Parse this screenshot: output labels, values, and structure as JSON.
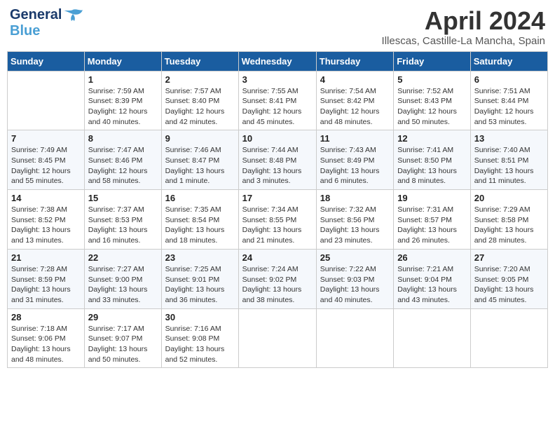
{
  "header": {
    "logo_line1": "General",
    "logo_line2": "Blue",
    "title": "April 2024",
    "subtitle": "Illescas, Castille-La Mancha, Spain"
  },
  "days_of_week": [
    "Sunday",
    "Monday",
    "Tuesday",
    "Wednesday",
    "Thursday",
    "Friday",
    "Saturday"
  ],
  "weeks": [
    [
      {
        "day": "",
        "sunrise": "",
        "sunset": "",
        "daylight": ""
      },
      {
        "day": "1",
        "sunrise": "Sunrise: 7:59 AM",
        "sunset": "Sunset: 8:39 PM",
        "daylight": "Daylight: 12 hours and 40 minutes."
      },
      {
        "day": "2",
        "sunrise": "Sunrise: 7:57 AM",
        "sunset": "Sunset: 8:40 PM",
        "daylight": "Daylight: 12 hours and 42 minutes."
      },
      {
        "day": "3",
        "sunrise": "Sunrise: 7:55 AM",
        "sunset": "Sunset: 8:41 PM",
        "daylight": "Daylight: 12 hours and 45 minutes."
      },
      {
        "day": "4",
        "sunrise": "Sunrise: 7:54 AM",
        "sunset": "Sunset: 8:42 PM",
        "daylight": "Daylight: 12 hours and 48 minutes."
      },
      {
        "day": "5",
        "sunrise": "Sunrise: 7:52 AM",
        "sunset": "Sunset: 8:43 PM",
        "daylight": "Daylight: 12 hours and 50 minutes."
      },
      {
        "day": "6",
        "sunrise": "Sunrise: 7:51 AM",
        "sunset": "Sunset: 8:44 PM",
        "daylight": "Daylight: 12 hours and 53 minutes."
      }
    ],
    [
      {
        "day": "7",
        "sunrise": "Sunrise: 7:49 AM",
        "sunset": "Sunset: 8:45 PM",
        "daylight": "Daylight: 12 hours and 55 minutes."
      },
      {
        "day": "8",
        "sunrise": "Sunrise: 7:47 AM",
        "sunset": "Sunset: 8:46 PM",
        "daylight": "Daylight: 12 hours and 58 minutes."
      },
      {
        "day": "9",
        "sunrise": "Sunrise: 7:46 AM",
        "sunset": "Sunset: 8:47 PM",
        "daylight": "Daylight: 13 hours and 1 minute."
      },
      {
        "day": "10",
        "sunrise": "Sunrise: 7:44 AM",
        "sunset": "Sunset: 8:48 PM",
        "daylight": "Daylight: 13 hours and 3 minutes."
      },
      {
        "day": "11",
        "sunrise": "Sunrise: 7:43 AM",
        "sunset": "Sunset: 8:49 PM",
        "daylight": "Daylight: 13 hours and 6 minutes."
      },
      {
        "day": "12",
        "sunrise": "Sunrise: 7:41 AM",
        "sunset": "Sunset: 8:50 PM",
        "daylight": "Daylight: 13 hours and 8 minutes."
      },
      {
        "day": "13",
        "sunrise": "Sunrise: 7:40 AM",
        "sunset": "Sunset: 8:51 PM",
        "daylight": "Daylight: 13 hours and 11 minutes."
      }
    ],
    [
      {
        "day": "14",
        "sunrise": "Sunrise: 7:38 AM",
        "sunset": "Sunset: 8:52 PM",
        "daylight": "Daylight: 13 hours and 13 minutes."
      },
      {
        "day": "15",
        "sunrise": "Sunrise: 7:37 AM",
        "sunset": "Sunset: 8:53 PM",
        "daylight": "Daylight: 13 hours and 16 minutes."
      },
      {
        "day": "16",
        "sunrise": "Sunrise: 7:35 AM",
        "sunset": "Sunset: 8:54 PM",
        "daylight": "Daylight: 13 hours and 18 minutes."
      },
      {
        "day": "17",
        "sunrise": "Sunrise: 7:34 AM",
        "sunset": "Sunset: 8:55 PM",
        "daylight": "Daylight: 13 hours and 21 minutes."
      },
      {
        "day": "18",
        "sunrise": "Sunrise: 7:32 AM",
        "sunset": "Sunset: 8:56 PM",
        "daylight": "Daylight: 13 hours and 23 minutes."
      },
      {
        "day": "19",
        "sunrise": "Sunrise: 7:31 AM",
        "sunset": "Sunset: 8:57 PM",
        "daylight": "Daylight: 13 hours and 26 minutes."
      },
      {
        "day": "20",
        "sunrise": "Sunrise: 7:29 AM",
        "sunset": "Sunset: 8:58 PM",
        "daylight": "Daylight: 13 hours and 28 minutes."
      }
    ],
    [
      {
        "day": "21",
        "sunrise": "Sunrise: 7:28 AM",
        "sunset": "Sunset: 8:59 PM",
        "daylight": "Daylight: 13 hours and 31 minutes."
      },
      {
        "day": "22",
        "sunrise": "Sunrise: 7:27 AM",
        "sunset": "Sunset: 9:00 PM",
        "daylight": "Daylight: 13 hours and 33 minutes."
      },
      {
        "day": "23",
        "sunrise": "Sunrise: 7:25 AM",
        "sunset": "Sunset: 9:01 PM",
        "daylight": "Daylight: 13 hours and 36 minutes."
      },
      {
        "day": "24",
        "sunrise": "Sunrise: 7:24 AM",
        "sunset": "Sunset: 9:02 PM",
        "daylight": "Daylight: 13 hours and 38 minutes."
      },
      {
        "day": "25",
        "sunrise": "Sunrise: 7:22 AM",
        "sunset": "Sunset: 9:03 PM",
        "daylight": "Daylight: 13 hours and 40 minutes."
      },
      {
        "day": "26",
        "sunrise": "Sunrise: 7:21 AM",
        "sunset": "Sunset: 9:04 PM",
        "daylight": "Daylight: 13 hours and 43 minutes."
      },
      {
        "day": "27",
        "sunrise": "Sunrise: 7:20 AM",
        "sunset": "Sunset: 9:05 PM",
        "daylight": "Daylight: 13 hours and 45 minutes."
      }
    ],
    [
      {
        "day": "28",
        "sunrise": "Sunrise: 7:18 AM",
        "sunset": "Sunset: 9:06 PM",
        "daylight": "Daylight: 13 hours and 48 minutes."
      },
      {
        "day": "29",
        "sunrise": "Sunrise: 7:17 AM",
        "sunset": "Sunset: 9:07 PM",
        "daylight": "Daylight: 13 hours and 50 minutes."
      },
      {
        "day": "30",
        "sunrise": "Sunrise: 7:16 AM",
        "sunset": "Sunset: 9:08 PM",
        "daylight": "Daylight: 13 hours and 52 minutes."
      },
      {
        "day": "",
        "sunrise": "",
        "sunset": "",
        "daylight": ""
      },
      {
        "day": "",
        "sunrise": "",
        "sunset": "",
        "daylight": ""
      },
      {
        "day": "",
        "sunrise": "",
        "sunset": "",
        "daylight": ""
      },
      {
        "day": "",
        "sunrise": "",
        "sunset": "",
        "daylight": ""
      }
    ]
  ]
}
